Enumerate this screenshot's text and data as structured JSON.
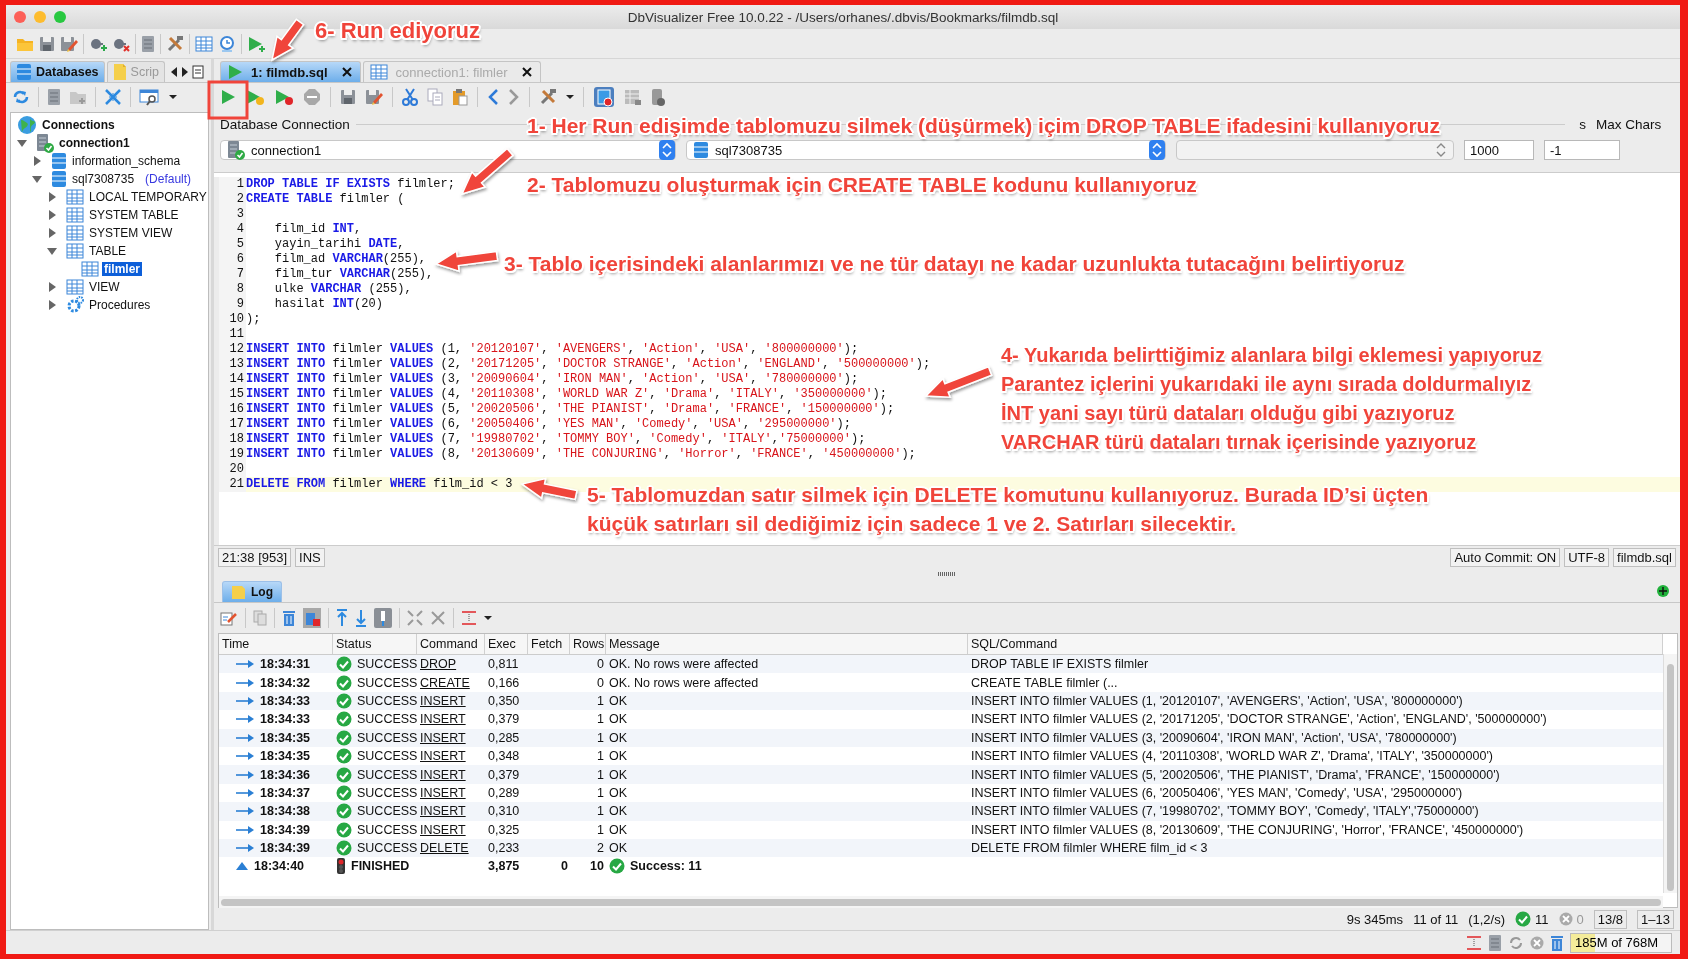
{
  "window": {
    "title": "DbVisualizer Free 10.0.22 - /Users/orhanes/.dbvis/Bookmarks/filmdb.sql"
  },
  "left_tabs": [
    {
      "label": "Databases",
      "selected": true
    },
    {
      "label": "Scrip",
      "selected": false
    }
  ],
  "tree": [
    {
      "label": "Connections",
      "kind": "root",
      "selected": false,
      "children": [
        {
          "label": "connection1",
          "kind": "connection",
          "selected": false,
          "expanded": true,
          "children": [
            {
              "label": "information_schema",
              "kind": "schema",
              "selected": false,
              "expanded": false
            },
            {
              "label": "sql7308735",
              "note": "(Default)",
              "kind": "schema",
              "selected": false,
              "expanded": true,
              "children": [
                {
                  "label": "LOCAL TEMPORARY",
                  "kind": "folder",
                  "selected": false,
                  "expanded": false
                },
                {
                  "label": "SYSTEM TABLE",
                  "kind": "folder",
                  "selected": false,
                  "expanded": false
                },
                {
                  "label": "SYSTEM VIEW",
                  "kind": "folder",
                  "selected": false,
                  "expanded": false
                },
                {
                  "label": "TABLE",
                  "kind": "folder",
                  "selected": false,
                  "expanded": true,
                  "children": [
                    {
                      "label": "filmler",
                      "kind": "table",
                      "selected": true
                    }
                  ]
                },
                {
                  "label": "VIEW",
                  "kind": "folder",
                  "selected": false,
                  "expanded": false
                },
                {
                  "label": "Procedures",
                  "kind": "procedures",
                  "selected": false,
                  "expanded": false
                }
              ]
            }
          ]
        }
      ]
    }
  ],
  "editor_tabs": [
    {
      "label": "1: filmdb.sql",
      "kind": "sql",
      "selected": true
    },
    {
      "label": "connection1: filmler",
      "kind": "table",
      "selected": false
    }
  ],
  "connection_bar": {
    "label": "Database Connection",
    "connection": "connection1",
    "database": "sql7308735",
    "max_rows_label": "s",
    "max_rows": "1000",
    "max_chars_label": "Max Chars",
    "max_chars": "-1"
  },
  "editor": {
    "lines": [
      {
        "number": "1",
        "current": false,
        "tokens": [
          {
            "kind": "keyword",
            "text": "DROP TABLE IF EXISTS"
          },
          {
            "kind": "plain",
            "text": " filmler;"
          }
        ]
      },
      {
        "number": "2",
        "current": false,
        "tokens": [
          {
            "kind": "keyword",
            "text": "CREATE TABLE"
          },
          {
            "kind": "plain",
            "text": " filmler ("
          }
        ]
      },
      {
        "number": "3",
        "current": false
      },
      {
        "number": "4",
        "current": false,
        "tokens": [
          {
            "kind": "plain",
            "text": "    film_id "
          },
          {
            "kind": "keyword",
            "text": "INT"
          },
          {
            "kind": "plain",
            "text": ","
          }
        ]
      },
      {
        "number": "5",
        "current": false,
        "tokens": [
          {
            "kind": "plain",
            "text": "    yayin_tarihi "
          },
          {
            "kind": "keyword",
            "text": "DATE"
          },
          {
            "kind": "plain",
            "text": ","
          }
        ]
      },
      {
        "number": "6",
        "current": false,
        "tokens": [
          {
            "kind": "plain",
            "text": "    film_ad "
          },
          {
            "kind": "keyword",
            "text": "VARCHAR"
          },
          {
            "kind": "plain",
            "text": "(255),"
          }
        ]
      },
      {
        "number": "7",
        "current": false,
        "tokens": [
          {
            "kind": "plain",
            "text": "    film_tur "
          },
          {
            "kind": "keyword",
            "text": "VARCHAR"
          },
          {
            "kind": "plain",
            "text": "(255),"
          }
        ]
      },
      {
        "number": "8",
        "current": false,
        "tokens": [
          {
            "kind": "plain",
            "text": "    ulke "
          },
          {
            "kind": "keyword",
            "text": "VARCHAR"
          },
          {
            "kind": "plain",
            "text": " (255),"
          }
        ]
      },
      {
        "number": "9",
        "current": false,
        "tokens": [
          {
            "kind": "plain",
            "text": "    hasilat "
          },
          {
            "kind": "keyword",
            "text": "INT"
          },
          {
            "kind": "plain",
            "text": "(20)"
          }
        ]
      },
      {
        "number": "10",
        "current": false,
        "tokens": [
          {
            "kind": "plain",
            "text": ");"
          }
        ]
      },
      {
        "number": "11",
        "current": false
      },
      {
        "number": "12",
        "current": false,
        "tokens": [
          {
            "kind": "keyword",
            "text": "INSERT INTO"
          },
          {
            "kind": "plain",
            "text": " filmler "
          },
          {
            "kind": "keyword",
            "text": "VALUES"
          },
          {
            "kind": "plain",
            "text": " (1, "
          },
          {
            "kind": "string",
            "text": "'20120107'"
          },
          {
            "kind": "plain",
            "text": ", "
          },
          {
            "kind": "string",
            "text": "'AVENGERS'"
          },
          {
            "kind": "plain",
            "text": ", "
          },
          {
            "kind": "string",
            "text": "'Action'"
          },
          {
            "kind": "plain",
            "text": ", "
          },
          {
            "kind": "string",
            "text": "'USA'"
          },
          {
            "kind": "plain",
            "text": ", "
          },
          {
            "kind": "string",
            "text": "'800000000'"
          },
          {
            "kind": "plain",
            "text": ");"
          }
        ]
      },
      {
        "number": "13",
        "current": false,
        "tokens": [
          {
            "kind": "keyword",
            "text": "INSERT INTO"
          },
          {
            "kind": "plain",
            "text": " filmler "
          },
          {
            "kind": "keyword",
            "text": "VALUES"
          },
          {
            "kind": "plain",
            "text": " (2, "
          },
          {
            "kind": "string",
            "text": "'20171205'"
          },
          {
            "kind": "plain",
            "text": ", "
          },
          {
            "kind": "string",
            "text": "'DOCTOR STRANGE'"
          },
          {
            "kind": "plain",
            "text": ", "
          },
          {
            "kind": "string",
            "text": "'Action'"
          },
          {
            "kind": "plain",
            "text": ", "
          },
          {
            "kind": "string",
            "text": "'ENGLAND'"
          },
          {
            "kind": "plain",
            "text": ", "
          },
          {
            "kind": "string",
            "text": "'500000000'"
          },
          {
            "kind": "plain",
            "text": ");"
          }
        ]
      },
      {
        "number": "14",
        "current": false,
        "tokens": [
          {
            "kind": "keyword",
            "text": "INSERT INTO"
          },
          {
            "kind": "plain",
            "text": " filmler "
          },
          {
            "kind": "keyword",
            "text": "VALUES"
          },
          {
            "kind": "plain",
            "text": " (3, "
          },
          {
            "kind": "string",
            "text": "'20090604'"
          },
          {
            "kind": "plain",
            "text": ", "
          },
          {
            "kind": "string",
            "text": "'IRON MAN'"
          },
          {
            "kind": "plain",
            "text": ", "
          },
          {
            "kind": "string",
            "text": "'Action'"
          },
          {
            "kind": "plain",
            "text": ", "
          },
          {
            "kind": "string",
            "text": "'USA'"
          },
          {
            "kind": "plain",
            "text": ", "
          },
          {
            "kind": "string",
            "text": "'780000000'"
          },
          {
            "kind": "plain",
            "text": ");"
          }
        ]
      },
      {
        "number": "15",
        "current": false,
        "tokens": [
          {
            "kind": "keyword",
            "text": "INSERT INTO"
          },
          {
            "kind": "plain",
            "text": " filmler "
          },
          {
            "kind": "keyword",
            "text": "VALUES"
          },
          {
            "kind": "plain",
            "text": " (4, "
          },
          {
            "kind": "string",
            "text": "'20110308'"
          },
          {
            "kind": "plain",
            "text": ", "
          },
          {
            "kind": "string",
            "text": "'WORLD WAR Z'"
          },
          {
            "kind": "plain",
            "text": ", "
          },
          {
            "kind": "string",
            "text": "'Drama'"
          },
          {
            "kind": "plain",
            "text": ", "
          },
          {
            "kind": "string",
            "text": "'ITALY'"
          },
          {
            "kind": "plain",
            "text": ", "
          },
          {
            "kind": "string",
            "text": "'350000000'"
          },
          {
            "kind": "plain",
            "text": ");"
          }
        ]
      },
      {
        "number": "16",
        "current": false,
        "tokens": [
          {
            "kind": "keyword",
            "text": "INSERT INTO"
          },
          {
            "kind": "plain",
            "text": " filmler "
          },
          {
            "kind": "keyword",
            "text": "VALUES"
          },
          {
            "kind": "plain",
            "text": " (5, "
          },
          {
            "kind": "string",
            "text": "'20020506'"
          },
          {
            "kind": "plain",
            "text": ", "
          },
          {
            "kind": "string",
            "text": "'THE PIANIST'"
          },
          {
            "kind": "plain",
            "text": ", "
          },
          {
            "kind": "string",
            "text": "'Drama'"
          },
          {
            "kind": "plain",
            "text": ", "
          },
          {
            "kind": "string",
            "text": "'FRANCE'"
          },
          {
            "kind": "plain",
            "text": ", "
          },
          {
            "kind": "string",
            "text": "'150000000'"
          },
          {
            "kind": "plain",
            "text": ");"
          }
        ]
      },
      {
        "number": "17",
        "current": false,
        "tokens": [
          {
            "kind": "keyword",
            "text": "INSERT INTO"
          },
          {
            "kind": "plain",
            "text": " filmler "
          },
          {
            "kind": "keyword",
            "text": "VALUES"
          },
          {
            "kind": "plain",
            "text": " (6, "
          },
          {
            "kind": "string",
            "text": "'20050406'"
          },
          {
            "kind": "plain",
            "text": ", "
          },
          {
            "kind": "string",
            "text": "'YES MAN'"
          },
          {
            "kind": "plain",
            "text": ", "
          },
          {
            "kind": "string",
            "text": "'Comedy'"
          },
          {
            "kind": "plain",
            "text": ", "
          },
          {
            "kind": "string",
            "text": "'USA'"
          },
          {
            "kind": "plain",
            "text": ", "
          },
          {
            "kind": "string",
            "text": "'295000000'"
          },
          {
            "kind": "plain",
            "text": ");"
          }
        ]
      },
      {
        "number": "18",
        "current": false,
        "tokens": [
          {
            "kind": "keyword",
            "text": "INSERT INTO"
          },
          {
            "kind": "plain",
            "text": " filmler "
          },
          {
            "kind": "keyword",
            "text": "VALUES"
          },
          {
            "kind": "plain",
            "text": " (7, "
          },
          {
            "kind": "string",
            "text": "'19980702'"
          },
          {
            "kind": "plain",
            "text": ", "
          },
          {
            "kind": "string",
            "text": "'TOMMY BOY'"
          },
          {
            "kind": "plain",
            "text": ", "
          },
          {
            "kind": "string",
            "text": "'Comedy'"
          },
          {
            "kind": "plain",
            "text": ", "
          },
          {
            "kind": "string",
            "text": "'ITALY'"
          },
          {
            "kind": "plain",
            "text": ","
          },
          {
            "kind": "string",
            "text": "'75000000'"
          },
          {
            "kind": "plain",
            "text": ");"
          }
        ]
      },
      {
        "number": "19",
        "current": false,
        "tokens": [
          {
            "kind": "keyword",
            "text": "INSERT INTO"
          },
          {
            "kind": "plain",
            "text": " filmler "
          },
          {
            "kind": "keyword",
            "text": "VALUES"
          },
          {
            "kind": "plain",
            "text": " (8, "
          },
          {
            "kind": "string",
            "text": "'20130609'"
          },
          {
            "kind": "plain",
            "text": ", "
          },
          {
            "kind": "string",
            "text": "'THE CONJURING'"
          },
          {
            "kind": "plain",
            "text": ", "
          },
          {
            "kind": "string",
            "text": "'Horror'"
          },
          {
            "kind": "plain",
            "text": ", "
          },
          {
            "kind": "string",
            "text": "'FRANCE'"
          },
          {
            "kind": "plain",
            "text": ", "
          },
          {
            "kind": "string",
            "text": "'450000000'"
          },
          {
            "kind": "plain",
            "text": ");"
          }
        ]
      },
      {
        "number": "20",
        "current": false
      },
      {
        "number": "21",
        "current": true,
        "tokens": [
          {
            "kind": "keyword",
            "text": "DELETE FROM"
          },
          {
            "kind": "plain",
            "text": " filmler "
          },
          {
            "kind": "keyword",
            "text": "WHERE"
          },
          {
            "kind": "plain",
            "text": " film_id < 3"
          }
        ]
      }
    ]
  },
  "editor_status": {
    "position": "21:38 [953]",
    "mode": "INS",
    "auto_commit": "Auto Commit: ON",
    "encoding": "UTF-8",
    "file": "filmdb.sql"
  },
  "log": {
    "tab": "Log",
    "columns": [
      "Time",
      "Status",
      "Command",
      "Exec",
      "Fetch",
      "Rows",
      "Message",
      "SQL/Command"
    ],
    "rows": [
      {
        "kind": "success",
        "time": "18:34:31",
        "status": "SUCCESS",
        "command": "DROP",
        "exec": "0,811",
        "rows": "0",
        "message": "OK. No rows were affected",
        "sql": "DROP TABLE IF EXISTS filmler"
      },
      {
        "kind": "success",
        "time": "18:34:32",
        "status": "SUCCESS",
        "command": "CREATE",
        "exec": "0,166",
        "rows": "0",
        "message": "OK. No rows were affected",
        "sql": "CREATE TABLE filmler (..."
      },
      {
        "kind": "success",
        "time": "18:34:33",
        "status": "SUCCESS",
        "command": "INSERT",
        "exec": "0,350",
        "rows": "1",
        "message": "OK",
        "sql": "INSERT INTO filmler VALUES (1, '20120107', 'AVENGERS', 'Action', 'USA', '800000000')"
      },
      {
        "kind": "success",
        "time": "18:34:33",
        "status": "SUCCESS",
        "command": "INSERT",
        "exec": "0,379",
        "rows": "1",
        "message": "OK",
        "sql": "INSERT INTO filmler VALUES (2, '20171205', 'DOCTOR STRANGE', 'Action', 'ENGLAND', '500000000')"
      },
      {
        "kind": "success",
        "time": "18:34:35",
        "status": "SUCCESS",
        "command": "INSERT",
        "exec": "0,285",
        "rows": "1",
        "message": "OK",
        "sql": "INSERT INTO filmler VALUES (3, '20090604', 'IRON MAN', 'Action', 'USA', '780000000')"
      },
      {
        "kind": "success",
        "time": "18:34:35",
        "status": "SUCCESS",
        "command": "INSERT",
        "exec": "0,348",
        "rows": "1",
        "message": "OK",
        "sql": "INSERT INTO filmler VALUES (4, '20110308', 'WORLD WAR Z', 'Drama', 'ITALY', '350000000')"
      },
      {
        "kind": "success",
        "time": "18:34:36",
        "status": "SUCCESS",
        "command": "INSERT",
        "exec": "0,379",
        "rows": "1",
        "message": "OK",
        "sql": "INSERT INTO filmler VALUES (5, '20020506', 'THE PIANIST', 'Drama', 'FRANCE', '150000000')"
      },
      {
        "kind": "success",
        "time": "18:34:37",
        "status": "SUCCESS",
        "command": "INSERT",
        "exec": "0,289",
        "rows": "1",
        "message": "OK",
        "sql": "INSERT INTO filmler VALUES (6, '20050406', 'YES MAN', 'Comedy', 'USA', '295000000')"
      },
      {
        "kind": "success",
        "time": "18:34:38",
        "status": "SUCCESS",
        "command": "INSERT",
        "exec": "0,310",
        "rows": "1",
        "message": "OK",
        "sql": "INSERT INTO filmler VALUES (7, '19980702', 'TOMMY BOY', 'Comedy', 'ITALY','75000000')"
      },
      {
        "kind": "success",
        "time": "18:34:39",
        "status": "SUCCESS",
        "command": "INSERT",
        "exec": "0,325",
        "rows": "1",
        "message": "OK",
        "sql": "INSERT INTO filmler VALUES (8, '20130609', 'THE CONJURING', 'Horror', 'FRANCE', '450000000')"
      },
      {
        "kind": "success",
        "time": "18:34:39",
        "status": "SUCCESS",
        "command": "DELETE",
        "exec": "0,233",
        "rows": "2",
        "message": "OK",
        "sql": "DELETE FROM filmler WHERE film_id < 3"
      },
      {
        "kind": "finished",
        "time": "18:34:40",
        "status": "FINISHED",
        "exec": "3,875",
        "fetch": "0",
        "rows": "10",
        "message": "Success: 11"
      }
    ]
  },
  "log_summary": {
    "duration": "9s 345ms",
    "count": "11 of 11",
    "rate": "(1,2/s)",
    "successes": "11",
    "errors": "0",
    "ratio": "13/8",
    "range": "1–13"
  },
  "memory": {
    "text": "185M of 768M",
    "level": 0.24
  },
  "callouts": [
    {
      "lines": [
        "6- Run ediyoruz"
      ]
    },
    {
      "lines": [
        "1- Her Run edişimde tablomuzu silmek (düşürmek) içim DROP TABLE ifadesini kullanıyoruz"
      ]
    },
    {
      "lines": [
        "2- Tablomuzu oluşturmak için CREATE TABLE kodunu kullanıyoruz"
      ]
    },
    {
      "lines": [
        "3- Tablo içerisindeki alanlarımızı ve ne tür datayı ne kadar uzunlukta tutacağını belirtiyoruz"
      ]
    },
    {
      "lines": [
        "4- Yukarıda belirttiğimiz alanlara bilgi eklemesi yapıyoruz",
        "Parantez içlerini yukarıdaki ile aynı sırada doldurmalıyız",
        "İNT yani sayı türü dataları olduğu gibi yazıyoruz",
        "VARCHAR türü dataları tırnak içerisinde yazıyoruz"
      ]
    },
    {
      "lines": [
        "5- Tablomuzdan satır silmek için DELETE komutunu kullanıyoruz. Burada ID’si üçten",
        "küçük satırları sil dediğimiz için sadece 1 ve 2. Satırları silecektir."
      ]
    }
  ]
}
